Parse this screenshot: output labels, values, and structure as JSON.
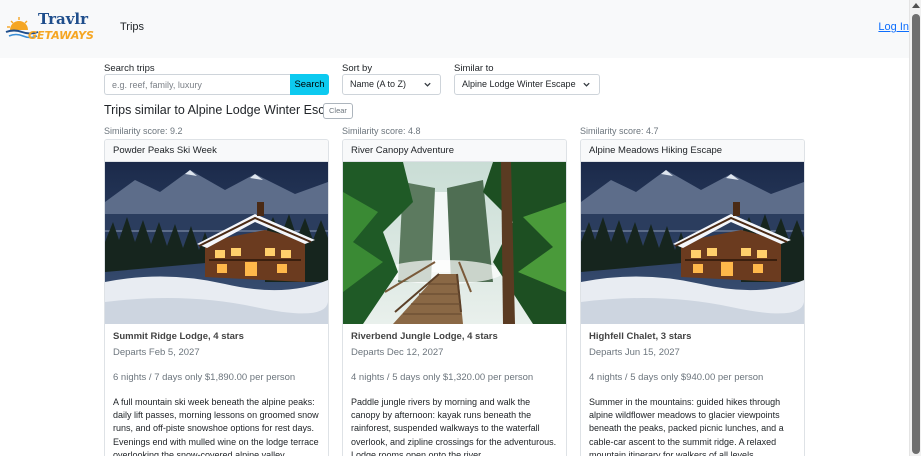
{
  "brand": {
    "name": "Travlr Getaways",
    "word1": "Travlr",
    "word2": "GETAWAYS"
  },
  "nav": {
    "trips": "Trips",
    "login": "Log In"
  },
  "filters": {
    "search_label": "Search trips",
    "search_placeholder": "e.g. reef, family, luxury",
    "search_value": "",
    "search_button": "Search",
    "sort_label": "Sort by",
    "sort_value": "Name (A to Z)",
    "similar_label": "Similar to",
    "similar_value": "Alpine Lodge Winter Escape"
  },
  "heading": {
    "title": "Trips similar to Alpine Lodge Winter Escape",
    "clear": "Clear"
  },
  "trips": [
    {
      "score": "Similarity score: 9.2",
      "name": "Powder Peaks Ski Week",
      "image": "snowy-chalet-image",
      "lodge": "Summit Ridge Lodge, 4 stars",
      "departs": "Departs Feb 5, 2027",
      "price": "6 nights / 7 days only $1,890.00 per person",
      "description": "A full mountain ski week beneath the alpine peaks: daily lift passes, morning lessons on groomed snow runs, and off-piste snowshoe options for rest days. Evenings end with mulled wine on the lodge terrace overlooking the snow-covered alpine valley."
    },
    {
      "score": "Similarity score: 4.8",
      "name": "River Canopy Adventure",
      "image": "jungle-waterfall-image",
      "lodge": "Riverbend Jungle Lodge, 4 stars",
      "departs": "Departs Dec 12, 2027",
      "price": "4 nights / 5 days only $1,320.00 per person",
      "description": "Paddle jungle rivers by morning and walk the canopy by afternoon: kayak runs beneath the rainforest, suspended walkways to the waterfall overlook, and zipline crossings for the adventurous. Lodge rooms open onto the river."
    },
    {
      "score": "Similarity score: 4.7",
      "name": "Alpine Meadows Hiking Escape",
      "image": "snowy-chalet-image",
      "lodge": "Highfell Chalet, 3 stars",
      "departs": "Departs Jun 15, 2027",
      "price": "4 nights / 5 days only $940.00 per person",
      "description": "Summer in the mountains: guided hikes through alpine wildflower meadows to glacier viewpoints beneath the peaks, packed picnic lunches, and a cable-car ascent to the summit ridge. A relaxed mountain itinerary for walkers of all levels."
    }
  ],
  "colors": {
    "accent": "#0dcaf0",
    "link": "#0d6efd",
    "logo_blue": "#1f4e8c",
    "logo_orange": "#f5a623"
  }
}
